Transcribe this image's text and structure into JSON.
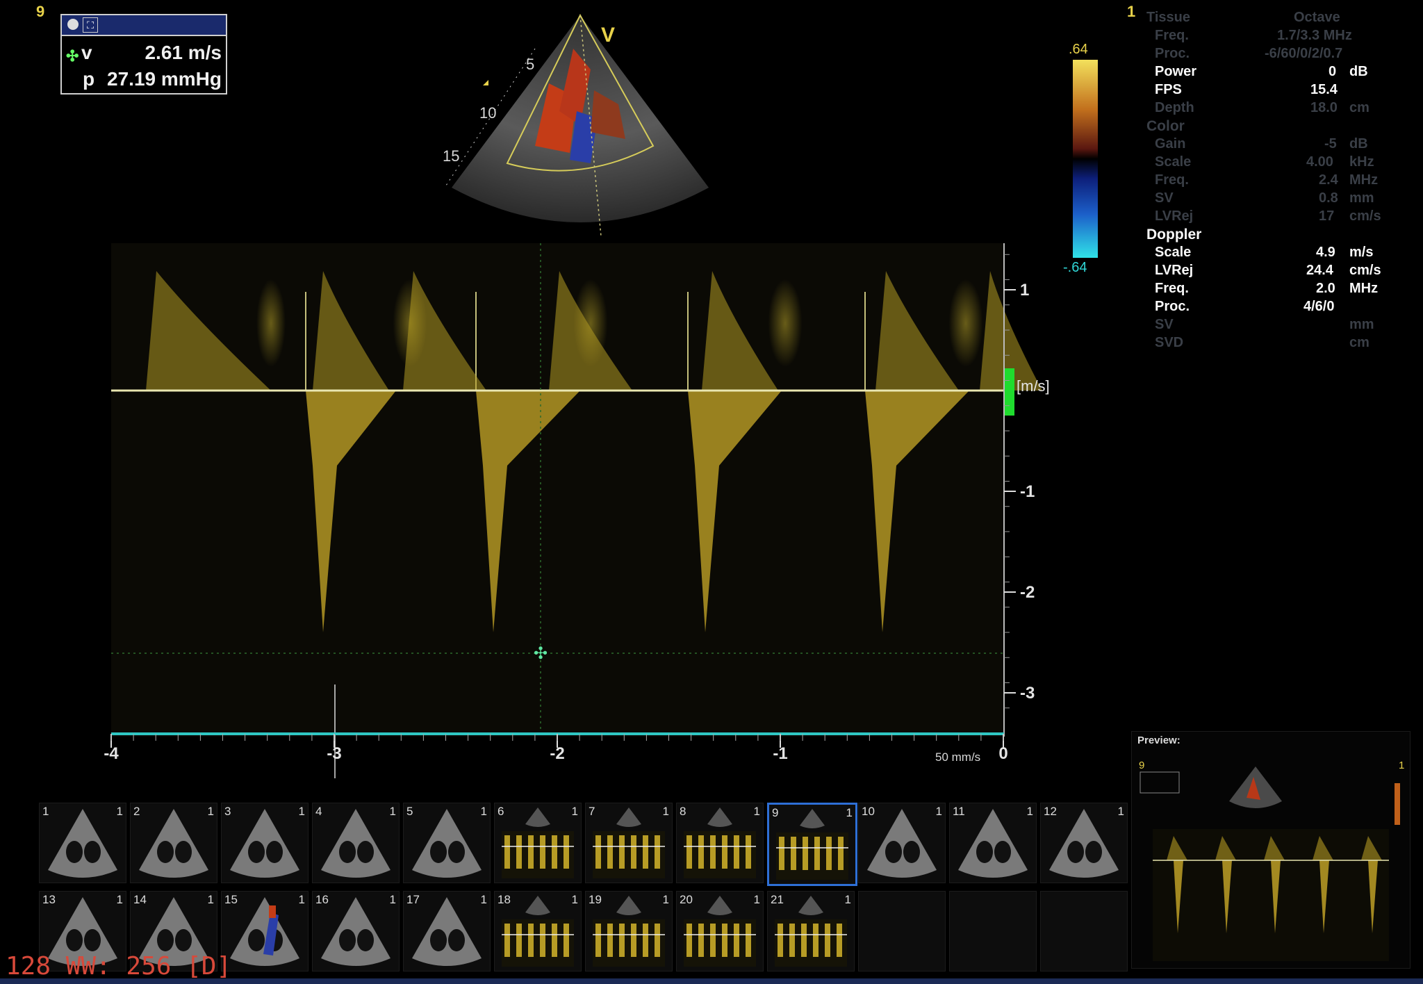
{
  "frame_number": "9",
  "top_right_index": "1",
  "measurement": {
    "icon_glyph": "⛶",
    "velocity_label": "v",
    "velocity_value": "2.61 m/s",
    "pressure_label": "p",
    "pressure_value": "27.19 mmHg"
  },
  "sector": {
    "label_v": "V",
    "depth_5": "5",
    "depth_10": "10",
    "depth_15": "15"
  },
  "color_bar": {
    "top": ".64",
    "bottom": "-.64"
  },
  "params": {
    "tissue": {
      "label": "Tissue",
      "value": "Octave"
    },
    "tissue_freq": {
      "label": "Freq.",
      "value": "1.7/3.3  MHz"
    },
    "tissue_proc": {
      "label": "Proc.",
      "value": "-6/60/0/2/0.7"
    },
    "power": {
      "label": "Power",
      "value": "0",
      "unit": "dB"
    },
    "fps": {
      "label": "FPS",
      "value": "15.4"
    },
    "depth": {
      "label": "Depth",
      "value": "18.0",
      "unit": "cm"
    },
    "color": {
      "label": "Color"
    },
    "gain": {
      "label": "Gain",
      "value": "-5",
      "unit": "dB"
    },
    "scale": {
      "label": "Scale",
      "value": "4.00",
      "unit": "kHz"
    },
    "color_freq": {
      "label": "Freq.",
      "value": "2.4",
      "unit": "MHz"
    },
    "sv": {
      "label": "SV",
      "value": "0.8",
      "unit": "mm"
    },
    "lvrej": {
      "label": "LVRej",
      "value": "17",
      "unit": "cm/s"
    },
    "doppler": {
      "label": "Doppler"
    },
    "d_scale": {
      "label": "Scale",
      "value": "4.9",
      "unit": "m/s"
    },
    "d_lvrej": {
      "label": "LVRej",
      "value": "24.4",
      "unit": "cm/s"
    },
    "d_freq": {
      "label": "Freq.",
      "value": "2.0",
      "unit": "MHz"
    },
    "d_proc": {
      "label": "Proc.",
      "value": "4/6/0"
    },
    "d_sv": {
      "label": "SV",
      "unit": "mm"
    },
    "d_svd": {
      "label": "SVD",
      "unit": "cm"
    }
  },
  "spectral": {
    "unit_label": "[m/s]",
    "y_ticks": [
      "1",
      "-1",
      "-2",
      "-3"
    ],
    "x_ticks": [
      "-4",
      "-3",
      "-2",
      "-1",
      "0"
    ],
    "sweep_label": "50 mm/s"
  },
  "thumbnails": [
    {
      "n": "1",
      "c": "1",
      "kind": "2d"
    },
    {
      "n": "2",
      "c": "1",
      "kind": "2d"
    },
    {
      "n": "3",
      "c": "1",
      "kind": "2d"
    },
    {
      "n": "4",
      "c": "1",
      "kind": "2d"
    },
    {
      "n": "5",
      "c": "1",
      "kind": "2d"
    },
    {
      "n": "6",
      "c": "1",
      "kind": "doppler"
    },
    {
      "n": "7",
      "c": "1",
      "kind": "doppler"
    },
    {
      "n": "8",
      "c": "1",
      "kind": "doppler"
    },
    {
      "n": "9",
      "c": "1",
      "kind": "doppler",
      "selected": true
    },
    {
      "n": "10",
      "c": "1",
      "kind": "2d"
    },
    {
      "n": "11",
      "c": "1",
      "kind": "2d"
    },
    {
      "n": "12",
      "c": "1",
      "kind": "2d"
    },
    {
      "n": "13",
      "c": "1",
      "kind": "2d"
    },
    {
      "n": "14",
      "c": "1",
      "kind": "2d"
    },
    {
      "n": "15",
      "c": "1",
      "kind": "color"
    },
    {
      "n": "16",
      "c": "1",
      "kind": "2d"
    },
    {
      "n": "17",
      "c": "1",
      "kind": "2d"
    },
    {
      "n": "18",
      "c": "1",
      "kind": "doppler"
    },
    {
      "n": "19",
      "c": "1",
      "kind": "doppler"
    },
    {
      "n": "20",
      "c": "1",
      "kind": "doppler"
    },
    {
      "n": "21",
      "c": "1",
      "kind": "doppler"
    }
  ],
  "preview": {
    "title": "Preview:",
    "frame": "9",
    "index": "1"
  },
  "status_line": "128 WW: 256 [D]",
  "colors": {
    "trace": "#e6c630",
    "baseline": "#e9e6b0",
    "axis_cyan": "#2fc7c4",
    "marker_green": "#1fdc2e",
    "selected_border": "#2e6fd6"
  }
}
